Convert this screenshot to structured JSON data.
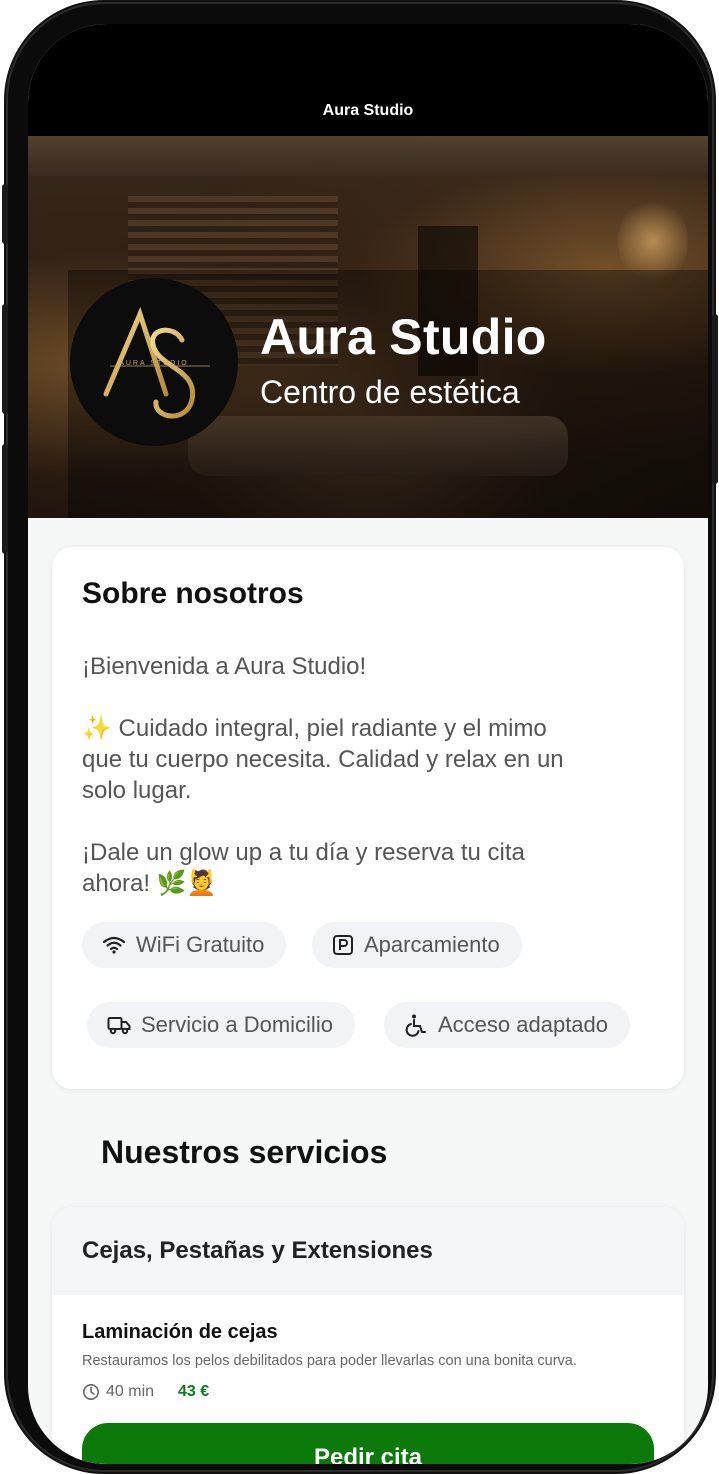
{
  "status_bar": {
    "title": "Aura Studio"
  },
  "hero": {
    "logo_alt": "AS AURA STUDIO",
    "business_name": "Aura Studio",
    "category": "Centro de estética"
  },
  "about": {
    "title": "Sobre nosotros",
    "welcome": "¡Bienvenida a Aura Studio!",
    "line1": "✨ Cuidado integral, piel radiante y el mimo",
    "line2": "que tu cuerpo necesita. Calidad y relax en un",
    "line3": "solo lugar.",
    "line4": "¡Dale un glow up a tu día y reserva tu cita",
    "line5": "ahora! 🌿💆",
    "amenities": [
      {
        "label": "WiFi Gratuito",
        "icon": "wifi-icon"
      },
      {
        "label": "Aparcamiento",
        "icon": "parking-icon"
      },
      {
        "label": "Servicio a Domicilio",
        "icon": "truck-icon"
      },
      {
        "label": "Acceso adaptado",
        "icon": "wheelchair-icon"
      }
    ]
  },
  "services": {
    "title": "Nuestros servicios",
    "category": "Cejas, Pestañas y Extensiones",
    "items": [
      {
        "name": "Laminación de cejas",
        "description": "Restauramos los pelos debilitados para poder llevarlas con una bonita curva.",
        "duration": "40 min",
        "price": "43 €",
        "button": "Pedir cita"
      }
    ]
  },
  "colors": {
    "accent": "#0b7a0b",
    "price": "#0b7a1c"
  }
}
